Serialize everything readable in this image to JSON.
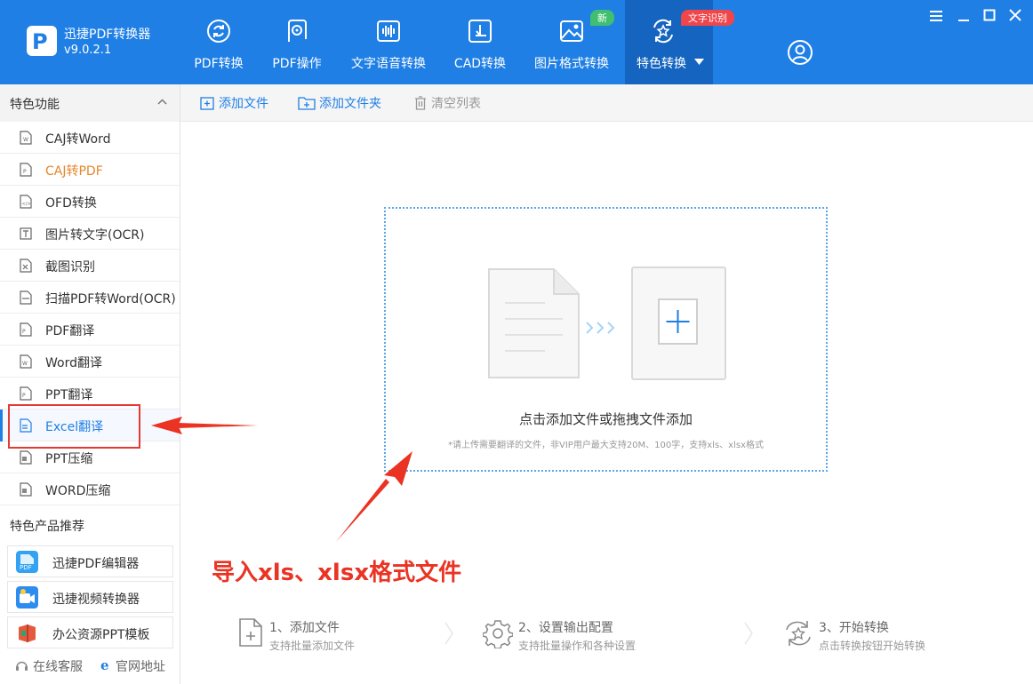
{
  "app": {
    "name": "迅捷PDF转换器",
    "version": "v9.0.2.1"
  },
  "nav": [
    {
      "label": "PDF转换",
      "icon": "refresh-pdf-icon"
    },
    {
      "label": "PDF操作",
      "icon": "gear-pdf-icon"
    },
    {
      "label": "文字语音转换",
      "icon": "audio-wave-icon"
    },
    {
      "label": "CAD转换",
      "icon": "cad-icon"
    },
    {
      "label": "图片格式转换",
      "icon": "image-icon"
    },
    {
      "label": "特色转换",
      "icon": "star-convert-icon",
      "active": true
    }
  ],
  "badges": {
    "new": "新",
    "ocr": "文字识别"
  },
  "sidebar": {
    "features_header": "特色功能",
    "items": [
      {
        "label": "CAJ转Word"
      },
      {
        "label": "CAJ转PDF"
      },
      {
        "label": "OFD转换"
      },
      {
        "label": "图片转文字(OCR)"
      },
      {
        "label": "截图识别"
      },
      {
        "label": "扫描PDF转Word(OCR)"
      },
      {
        "label": "PDF翻译"
      },
      {
        "label": "Word翻译"
      },
      {
        "label": "PPT翻译"
      },
      {
        "label": "Excel翻译"
      },
      {
        "label": "PPT压缩"
      },
      {
        "label": "WORD压缩"
      }
    ],
    "products_header": "特色产品推荐",
    "products": [
      {
        "label": "迅捷PDF编辑器"
      },
      {
        "label": "迅捷视频转换器"
      },
      {
        "label": "办公资源PPT模板"
      }
    ],
    "footer": {
      "support": "在线客服",
      "website": "官网地址"
    }
  },
  "toolbar": {
    "add_file": "添加文件",
    "add_folder": "添加文件夹",
    "clear_list": "清空列表"
  },
  "dropzone": {
    "main": "点击添加文件或拖拽文件添加",
    "sub": "*请上传需要翻译的文件，非VIP用户最大支持20M、100字，支持xls、xlsx格式"
  },
  "steps": [
    {
      "title": "1、添加文件",
      "desc": "支持批量添加文件"
    },
    {
      "title": "2、设置输出配置",
      "desc": "支持批量操作和各种设置"
    },
    {
      "title": "3、开始转换",
      "desc": "点击转换按钮开始转换"
    }
  ],
  "annotation": {
    "text": "导入xls、xlsx格式文件"
  },
  "colors": {
    "brand": "#1f7fe5",
    "accent_orange": "#e5862d",
    "annotation_red": "#ea3323"
  }
}
